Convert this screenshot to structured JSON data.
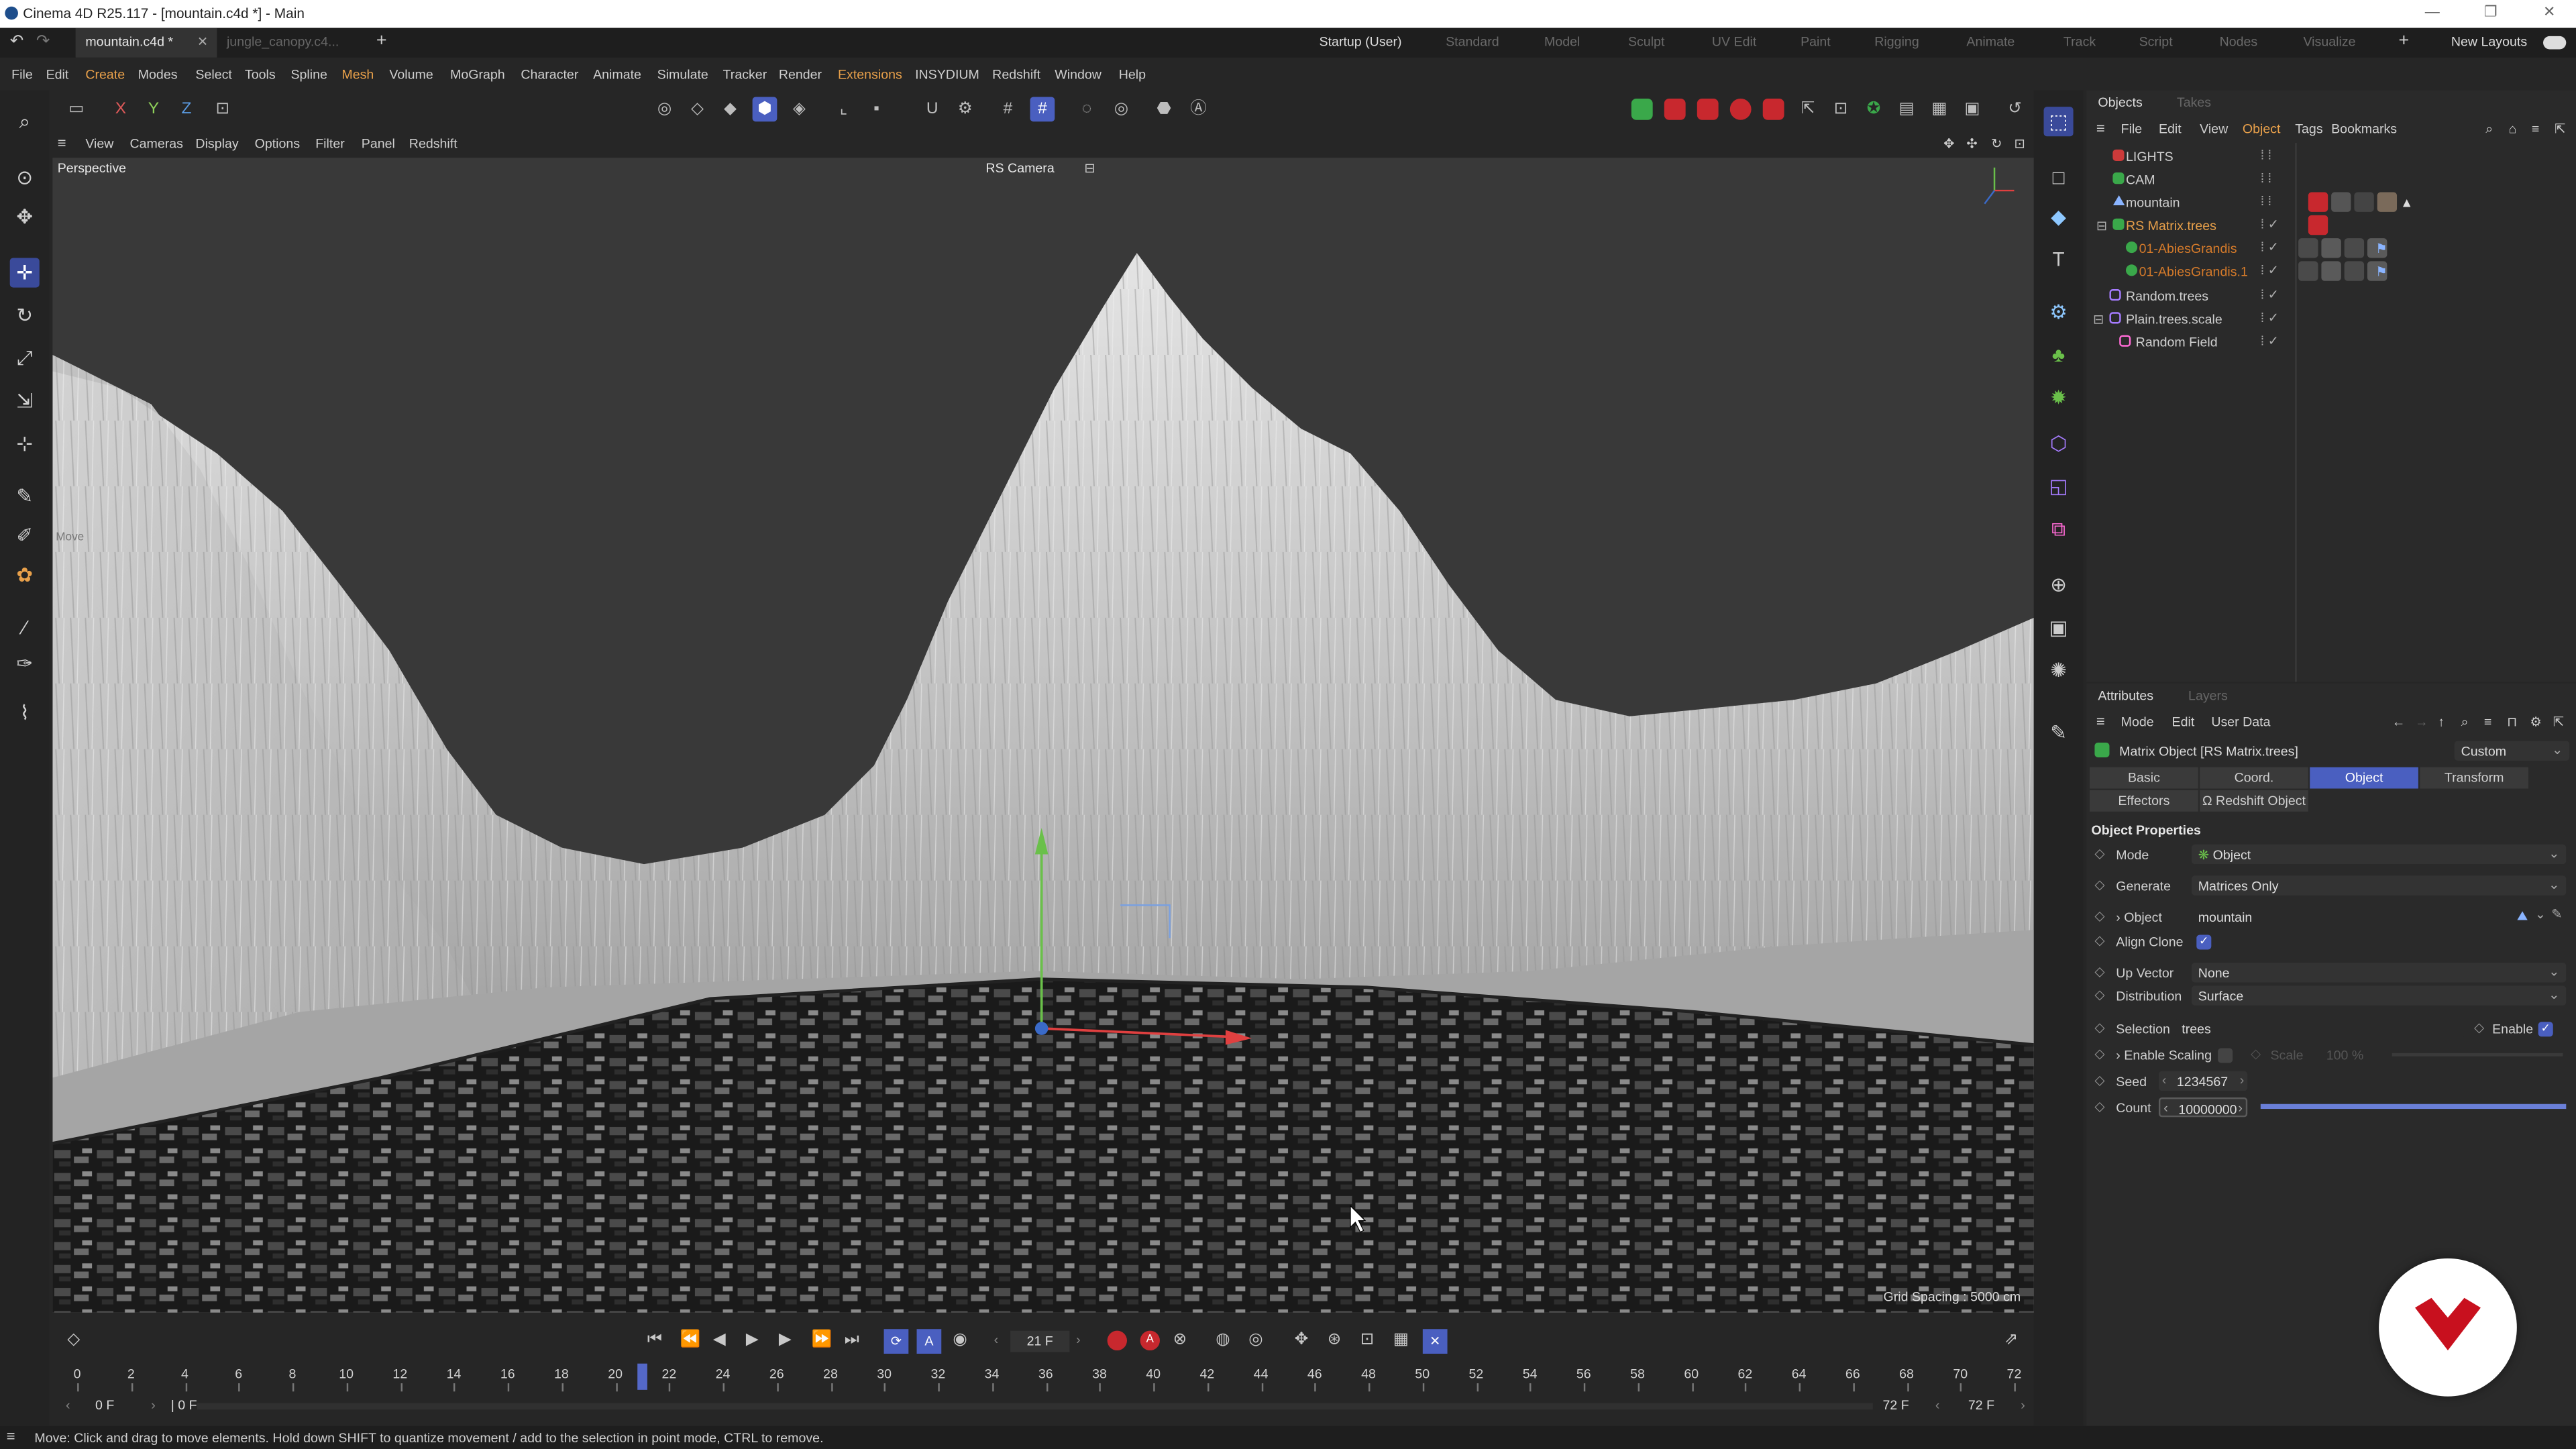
{
  "window": {
    "title": "Cinema 4D R25.117 - [mountain.c4d *] - Main",
    "controls": [
      "—",
      "❐",
      "✕"
    ]
  },
  "doc_tabs": [
    {
      "label": "mountain.c4d *",
      "close": "✕"
    },
    {
      "label": "jungle_canopy.c4..."
    }
  ],
  "add_tab": "+",
  "layouts": [
    "Startup (User)",
    "Standard",
    "Model",
    "Sculpt",
    "UV Edit",
    "Paint",
    "Rigging",
    "Animate",
    "Track",
    "Script",
    "Nodes",
    "Visualize"
  ],
  "new_layouts": "New Layouts",
  "menu": [
    "File",
    "Edit",
    "Create",
    "Modes",
    "Select",
    "Tools",
    "Spline",
    "Mesh",
    "Volume",
    "MoGraph",
    "Character",
    "Animate",
    "Simulate",
    "Tracker",
    "Render",
    "Extensions",
    "INSYDIUM",
    "Redshift",
    "Window",
    "Help"
  ],
  "toolbar_axes": [
    "X",
    "Y",
    "Z"
  ],
  "viewport_menu": [
    "View",
    "Cameras",
    "Display",
    "Options",
    "Filter",
    "Panel",
    "Redshift"
  ],
  "viewport": {
    "label": "Perspective",
    "camera": "RS Camera",
    "grid_spacing": "Grid Spacing : 5000 cm",
    "hud": "Move"
  },
  "objects_panel": {
    "tabs": [
      "Objects",
      "Takes"
    ],
    "menu": [
      "File",
      "Edit",
      "View",
      "Object",
      "Tags",
      "Bookmarks"
    ],
    "items": [
      {
        "name": "LIGHTS",
        "color": "#cc3a3a"
      },
      {
        "name": "CAM",
        "color": "#3aa84a"
      },
      {
        "name": "mountain",
        "color": "#8ab4ff"
      },
      {
        "name": "RS Matrix.trees",
        "color": "#e8a04a"
      },
      {
        "name": "01-AbiesGrandis",
        "color": "#d47a2a"
      },
      {
        "name": "01-AbiesGrandis.1",
        "color": "#d47a2a"
      },
      {
        "name": "Random.trees",
        "color": "#cfcfcf"
      },
      {
        "name": "Plain.trees.scale",
        "color": "#cfcfcf"
      },
      {
        "name": "Random Field",
        "color": "#cfcfcf"
      }
    ]
  },
  "attributes_panel": {
    "tabs": [
      "Attributes",
      "Layers"
    ],
    "menu": [
      "Mode",
      "Edit",
      "User Data"
    ],
    "object_title": "Matrix Object [RS Matrix.trees]",
    "preset": "Custom",
    "buttons": [
      "Basic",
      "Coord.",
      "Object",
      "Transform",
      "Effectors",
      "Ω Redshift Object"
    ],
    "section": "Object Properties",
    "props": {
      "mode_label": "Mode",
      "mode_value": "Object",
      "generate_label": "Generate",
      "generate_value": "Matrices Only",
      "object_label": "Object",
      "object_value": "mountain",
      "align_label": "Align Clone",
      "up_label": "Up Vector",
      "up_value": "None",
      "dist_label": "Distribution",
      "dist_value": "Surface",
      "sel_label": "Selection",
      "sel_value": "trees",
      "enable_label": "Enable",
      "scaling_label": "Enable Scaling",
      "scale_label": "Scale",
      "scale_value": "100 %",
      "seed_label": "Seed",
      "seed_value": "1234567",
      "count_label": "Count",
      "count_value": "10000000",
      "count_level": 1.0
    }
  },
  "transport": {
    "frame": "21 F"
  },
  "timeline": {
    "ticks": [
      "0",
      "2",
      "4",
      "6",
      "8",
      "10",
      "12",
      "14",
      "16",
      "18",
      "20",
      "22",
      "24",
      "26",
      "28",
      "30",
      "32",
      "34",
      "36",
      "38",
      "40",
      "42",
      "44",
      "46",
      "48",
      "50",
      "52",
      "54",
      "56",
      "58",
      "60",
      "62",
      "64",
      "66",
      "68",
      "70",
      "72"
    ],
    "current_frame": 21,
    "start": "0 F",
    "start2": "0 F",
    "end": "72 F",
    "end2": "72 F"
  },
  "status": "Move: Click and drag to move elements. Hold down SHIFT to quantize movement / add to the selection in point mode, CTRL to remove.",
  "colors": {
    "accent": "#4a5fc0",
    "menu_highlight": "#e8a04a",
    "record": "#c8282e"
  }
}
